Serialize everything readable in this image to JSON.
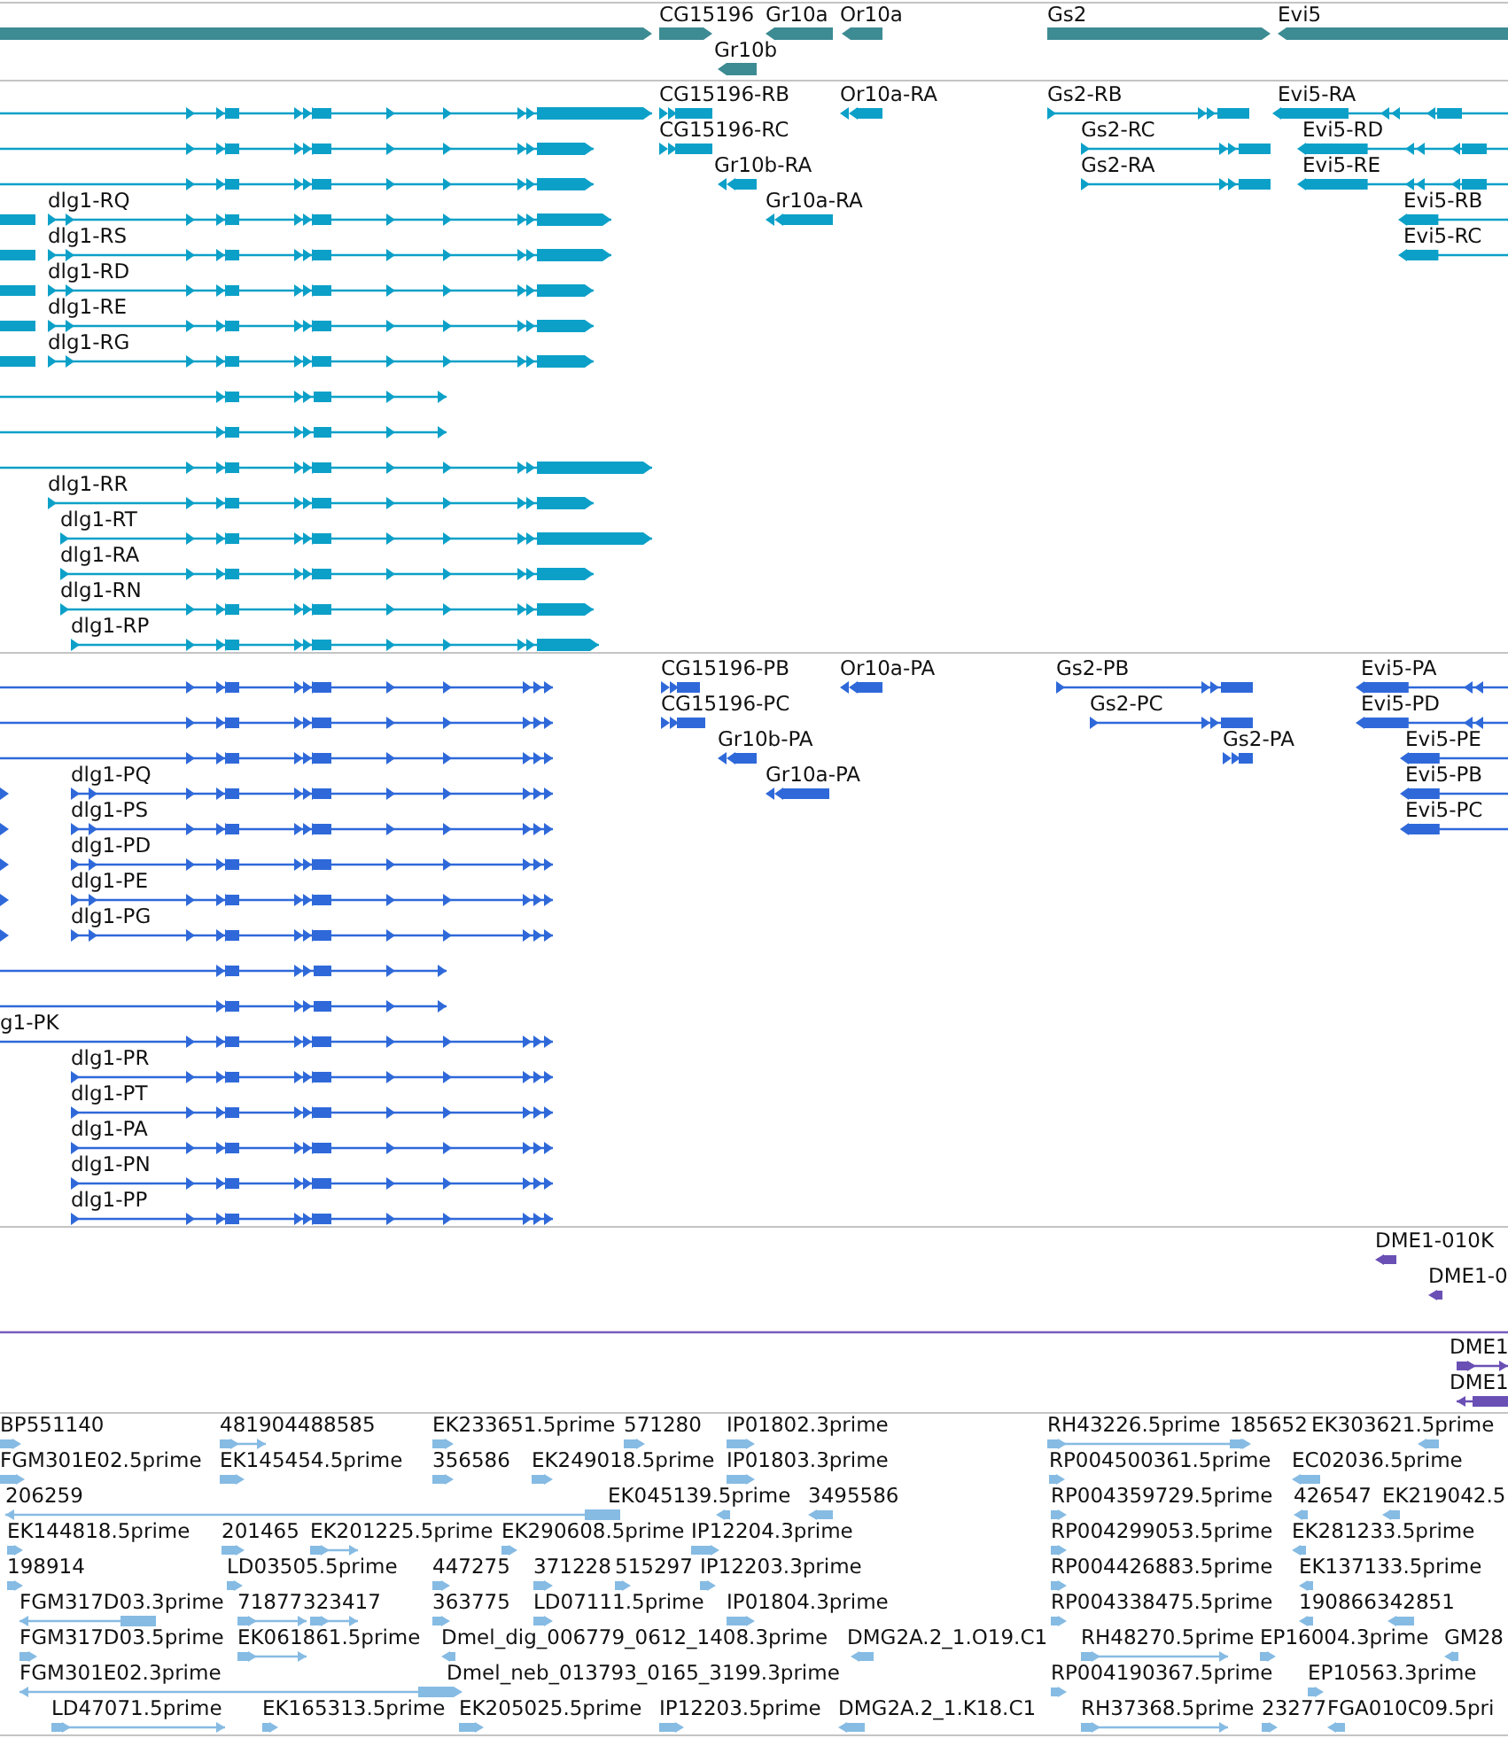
{
  "tracks": [
    {
      "kind": "gene",
      "features": [
        {
          "reverse": false
        },
        {
          "label": "CG15196",
          "reverse": false
        },
        {
          "label": "Gr10a",
          "reverse": true
        },
        {
          "label": "Or10a",
          "reverse": true
        },
        {
          "label": "Gr10b",
          "reverse": true
        },
        {
          "label": "Gs2",
          "reverse": false
        },
        {
          "label": "Evi5",
          "reverse": true
        }
      ]
    },
    {
      "kind": "mrna",
      "features": [
        {
          "reverse": false
        },
        {
          "reverse": false
        },
        {
          "reverse": false
        },
        {
          "label": "dlg1-RQ",
          "reverse": false
        },
        {
          "label": "dlg1-RS",
          "reverse": false
        },
        {
          "label": "dlg1-RD",
          "reverse": false
        },
        {
          "label": "dlg1-RE",
          "reverse": false
        },
        {
          "label": "dlg1-RG",
          "reverse": false
        },
        {
          "reverse": false
        },
        {
          "reverse": false
        },
        {
          "reverse": false
        },
        {
          "label": "dlg1-RR",
          "reverse": false
        },
        {
          "label": "dlg1-RT",
          "reverse": false
        },
        {
          "label": "dlg1-RA",
          "reverse": false
        },
        {
          "label": "dlg1-RN",
          "reverse": false
        },
        {
          "label": "dlg1-RP",
          "reverse": false
        },
        {
          "label": "CG15196-RB",
          "reverse": false
        },
        {
          "label": "CG15196-RC",
          "reverse": false
        },
        {
          "label": "Gr10b-RA",
          "reverse": true
        },
        {
          "label": "Gr10a-RA",
          "reverse": true
        },
        {
          "label": "Or10a-RA",
          "reverse": true
        },
        {
          "label": "Gs2-RB",
          "reverse": false
        },
        {
          "label": "Gs2-RC",
          "reverse": false
        },
        {
          "label": "Gs2-RA",
          "reverse": false
        },
        {
          "label": "Evi5-RA",
          "reverse": true
        },
        {
          "label": "Evi5-RD",
          "reverse": true
        },
        {
          "label": "Evi5-RE",
          "reverse": true
        },
        {
          "label": "Evi5-RB",
          "reverse": true
        },
        {
          "label": "Evi5-RC",
          "reverse": true
        }
      ]
    },
    {
      "kind": "protein",
      "features": [
        {
          "reverse": false
        },
        {
          "reverse": false
        },
        {
          "reverse": false
        },
        {
          "label": "dlg1-PQ",
          "reverse": false
        },
        {
          "label": "dlg1-PS",
          "reverse": false
        },
        {
          "label": "dlg1-PD",
          "reverse": false
        },
        {
          "label": "dlg1-PE",
          "reverse": false
        },
        {
          "label": "dlg1-PG",
          "reverse": false
        },
        {
          "reverse": false
        },
        {
          "reverse": false
        },
        {
          "label": "g1-PK",
          "reverse": false
        },
        {
          "label": "dlg1-PR",
          "reverse": false
        },
        {
          "label": "dlg1-PT",
          "reverse": false
        },
        {
          "label": "dlg1-PA",
          "reverse": false
        },
        {
          "label": "dlg1-PN",
          "reverse": false
        },
        {
          "label": "dlg1-PP",
          "reverse": false
        },
        {
          "label": "CG15196-PB",
          "reverse": false
        },
        {
          "label": "CG15196-PC",
          "reverse": false
        },
        {
          "label": "Gr10b-PA",
          "reverse": true
        },
        {
          "label": "Gr10a-PA",
          "reverse": true
        },
        {
          "label": "Or10a-PA",
          "reverse": true
        },
        {
          "label": "Gs2-PB",
          "reverse": false
        },
        {
          "label": "Gs2-PC",
          "reverse": false
        },
        {
          "label": "Gs2-PA",
          "reverse": false
        },
        {
          "label": "Evi5-PA",
          "reverse": true
        },
        {
          "label": "Evi5-PD",
          "reverse": true
        },
        {
          "label": "Evi5-PE",
          "reverse": true
        },
        {
          "label": "Evi5-PB",
          "reverse": true
        },
        {
          "label": "Evi5-PC",
          "reverse": true
        }
      ]
    },
    {
      "kind": "match",
      "features": [
        {
          "label": "DME1-010K",
          "reverse": true
        },
        {
          "label": "DME1-0",
          "reverse": true
        }
      ]
    },
    {
      "kind": "match",
      "features": [
        {
          "label": "DME1",
          "reverse": false
        },
        {
          "label": "DME1",
          "reverse": true
        }
      ]
    },
    {
      "kind": "est",
      "features": [
        {
          "label": "BP551140",
          "reverse": false
        },
        {
          "label": "481904488585",
          "reverse": false
        },
        {
          "label": "EK233651.5prime",
          "reverse": false
        },
        {
          "label": "571280",
          "reverse": false
        },
        {
          "label": "IP01802.3prime",
          "reverse": false
        },
        {
          "label": "RH43226.5prime",
          "reverse": false
        },
        {
          "label": "185652",
          "reverse": false
        },
        {
          "label": "EK303621.5prime",
          "reverse": true
        },
        {
          "label": "FGM301E02.5prime",
          "reverse": false
        },
        {
          "label": "EK145454.5prime",
          "reverse": false
        },
        {
          "label": "356586",
          "reverse": false
        },
        {
          "label": "EK249018.5prime",
          "reverse": false
        },
        {
          "label": "IP01803.3prime",
          "reverse": false
        },
        {
          "label": "RP004500361.5prime",
          "reverse": false
        },
        {
          "label": "EC02036.5prime",
          "reverse": true
        },
        {
          "label": "206259",
          "reverse": true
        },
        {
          "label": "EK045139.5prime",
          "reverse": true
        },
        {
          "label": "3495586",
          "reverse": true
        },
        {
          "label": "RP004359729.5prime",
          "reverse": false
        },
        {
          "label": "426547",
          "reverse": true
        },
        {
          "label": "EK219042.5",
          "reverse": true
        },
        {
          "label": "EK144818.5prime",
          "reverse": false
        },
        {
          "label": "201465",
          "reverse": false
        },
        {
          "label": "EK201225.5prime",
          "reverse": false
        },
        {
          "label": "EK290608.5prime",
          "reverse": false
        },
        {
          "label": "IP12204.3prime",
          "reverse": false
        },
        {
          "label": "RP004299053.5prime",
          "reverse": false
        },
        {
          "label": "EK281233.5prime",
          "reverse": true
        },
        {
          "label": "198914",
          "reverse": false
        },
        {
          "label": "LD03505.5prime",
          "reverse": false
        },
        {
          "label": "447275",
          "reverse": false
        },
        {
          "label": "371228",
          "reverse": false
        },
        {
          "label": "515297",
          "reverse": false
        },
        {
          "label": "IP12203.3prime",
          "reverse": false
        },
        {
          "label": "RP004426883.5prime",
          "reverse": false
        },
        {
          "label": "EK137133.5prime",
          "reverse": true
        },
        {
          "label": "FGM317D03.3prime",
          "reverse": true
        },
        {
          "label": "71877",
          "reverse": false
        },
        {
          "label": "323417",
          "reverse": false
        },
        {
          "label": "363775",
          "reverse": false
        },
        {
          "label": "LD07111.5prime",
          "reverse": false
        },
        {
          "label": "IP01804.3prime",
          "reverse": false
        },
        {
          "label": "RP004338475.5prime",
          "reverse": false
        },
        {
          "label": "190866",
          "reverse": true
        },
        {
          "label": "342851",
          "reverse": true
        },
        {
          "label": "FGM317D03.5prime",
          "reverse": false
        },
        {
          "label": "EK061861.5prime",
          "reverse": false
        },
        {
          "label": "Dmel_dig_006779_0612_1408.3prime",
          "reverse": true
        },
        {
          "label": "DMG2A.2_1.O19.C1",
          "reverse": true
        },
        {
          "label": "RH48270.5prime",
          "reverse": false
        },
        {
          "label": "EP16004.3prime",
          "reverse": false
        },
        {
          "label": "GM28",
          "reverse": true
        },
        {
          "label": "FGM301E02.3prime",
          "reverse": true
        },
        {
          "label": "Dmel_neb_013793_0165_3199.3prime",
          "reverse": false
        },
        {
          "label": "RP004190367.5prime",
          "reverse": false
        },
        {
          "label": "EP10563.3prime",
          "reverse": false
        },
        {
          "label": "LD47071.5prime",
          "reverse": false
        },
        {
          "label": "EK165313.5prime",
          "reverse": false
        },
        {
          "label": "EK205025.5prime",
          "reverse": false
        },
        {
          "label": "IP12203.5prime",
          "reverse": false
        },
        {
          "label": "DMG2A.2_1.K18.C1",
          "reverse": true
        },
        {
          "label": "RH37368.5prime",
          "reverse": false
        },
        {
          "label": "23277",
          "reverse": false
        },
        {
          "label": "FGA010C09.5pri",
          "reverse": true
        }
      ]
    }
  ]
}
